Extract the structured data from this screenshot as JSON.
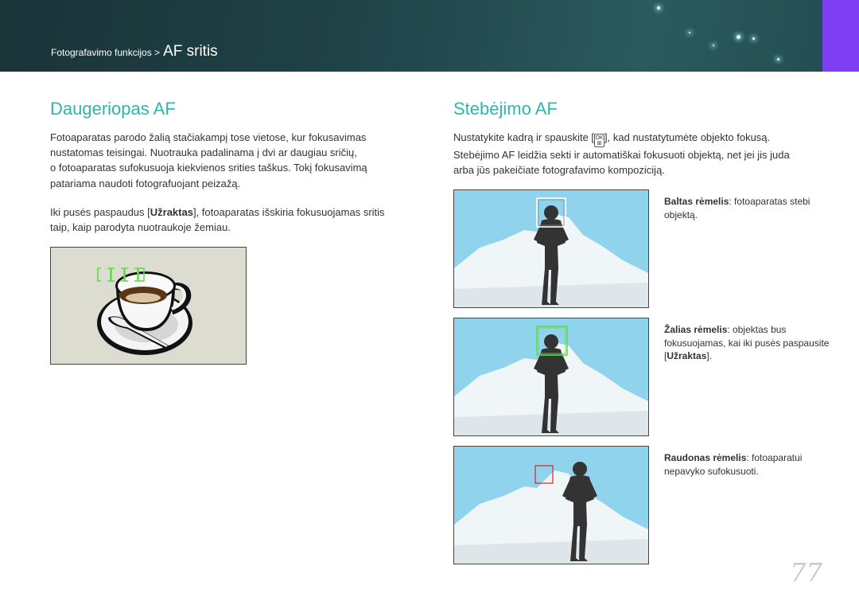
{
  "header": {
    "breadcrumb_parent": "Fotografavimo funkcijos >",
    "breadcrumb_current": "AF sritis"
  },
  "left": {
    "title": "Daugeriopas AF",
    "p1_lines": [
      "Fotoaparatas parodo žalią stačiakampį tose vietose, kur fokusavimas",
      "nustatomas teisingai. Nuotrauka padalinama į dvi ar daugiau sričių,",
      "o fotoaparatas sufokusuoja kiekvienos srities taškus. Tokį fokusavimą",
      "patariama naudoti fotografuojant peizažą."
    ],
    "p2_a": "Iki pusės paspaudus [",
    "p2_b": "Užraktas",
    "p2_c": "], fotoaparatas išskiria fokusuojamas sritis",
    "p2_line2": "taip, kaip parodyta nuotraukoje žemiau."
  },
  "right": {
    "title": "Stebėjimo AF",
    "p1_a": "Nustatykite kadrą ir spauskite [",
    "ok_top": "OK",
    "ok_bottom": "⊞",
    "p1_b": "], kad nustatytumėte objekto fokusą.",
    "p1_line2": "Stebėjimo AF leidžia sekti ir automatiškai fokusuoti objektą, net jei jis juda",
    "p1_line3": "arba jūs pakeičiate fotografavimo kompoziciją.",
    "captions": [
      {
        "bold": "Baltas rėmelis",
        "text": ": fotoaparatas stebi objektą."
      },
      {
        "bold": "Žalias rėmelis",
        "text": ": objektas bus fokusuojamas, kai iki pusės paspausite [",
        "bold2": "Užraktas",
        "text2": "]."
      },
      {
        "bold": "Raudonas rėmelis",
        "text": ": fotoaparatui nepavyko sufokusuoti."
      }
    ]
  },
  "colors": {
    "title": "#2ab8ad",
    "frame_white": "#ffffff",
    "frame_green": "#5fdc4a",
    "frame_red": "#e02020",
    "sky": "#8fd3ec",
    "accent_tab": "#7e3ff2"
  },
  "page_number": "77"
}
